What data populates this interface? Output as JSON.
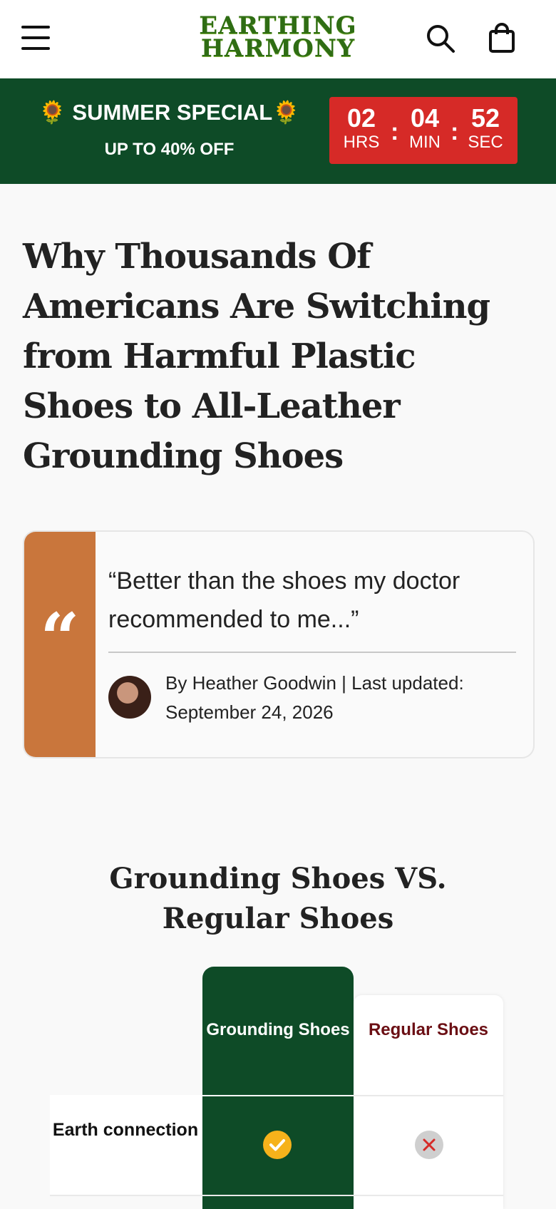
{
  "header": {
    "logo_line1": "EARTHING",
    "logo_line2": "HARMONY",
    "menu_icon": "hamburger-menu-icon",
    "search_icon": "search-icon",
    "cart_icon": "shopping-bag-icon"
  },
  "promo": {
    "title": "🌻 SUMMER SPECIAL🌻",
    "subtitle": "UP TO 40% OFF",
    "countdown": {
      "hours": "02",
      "hours_label": "HRS",
      "minutes": "04",
      "minutes_label": "MIN",
      "seconds": "52",
      "seconds_label": "SEC"
    },
    "colors": {
      "banner": "#0e4b27",
      "countdown": "#d62a27"
    }
  },
  "article": {
    "headline": "Why Thousands Of Americans Are Switching from Harmful Plastic Shoes to All-Leather Grounding Shoes",
    "quote": "“Better than the shoes my doctor recommended to me...”",
    "byline": "By Heather Goodwin | Last updated: September 24, 2026",
    "quote_mark": "“"
  },
  "comparison": {
    "title": "Grounding Shoes VS. Regular Shoes",
    "columns": [
      "Grounding Shoes",
      "Regular Shoes"
    ],
    "rows": [
      {
        "label": "Earth connection",
        "grounding": "check",
        "regular": "cross"
      }
    ],
    "colors": {
      "grounding": "#0e4b27",
      "check": "#f6b21b",
      "regular_text": "#6b0f14"
    }
  }
}
